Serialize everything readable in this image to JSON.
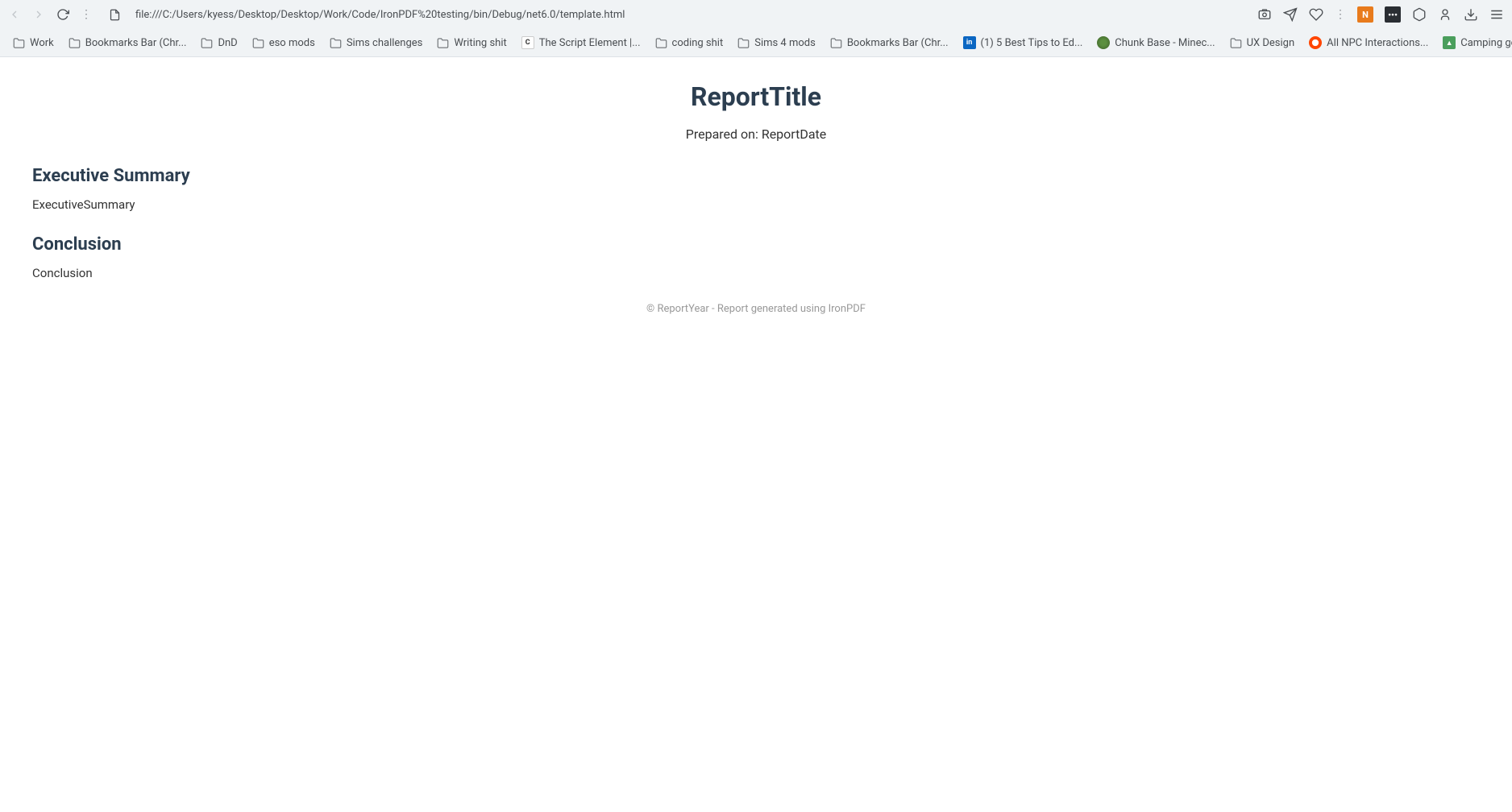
{
  "browser": {
    "url": "file:///C:/Users/kyess/Desktop/Desktop/Work/Code/IronPDF%20testing/bin/Debug/net6.0/template.html"
  },
  "bookmarks": [
    {
      "type": "folder",
      "label": "Work"
    },
    {
      "type": "folder",
      "label": "Bookmarks Bar (Chr..."
    },
    {
      "type": "folder",
      "label": "DnD"
    },
    {
      "type": "folder",
      "label": "eso mods"
    },
    {
      "type": "folder",
      "label": "Sims challenges"
    },
    {
      "type": "folder",
      "label": "Writing shit"
    },
    {
      "type": "script",
      "label": "The Script Element |..."
    },
    {
      "type": "folder",
      "label": "coding shit"
    },
    {
      "type": "folder",
      "label": "Sims 4 mods"
    },
    {
      "type": "folder",
      "label": "Bookmarks Bar (Chr..."
    },
    {
      "type": "linkedin",
      "label": "(1) 5 Best Tips to Ed..."
    },
    {
      "type": "chunkbase",
      "label": "Chunk Base - Minec..."
    },
    {
      "type": "folder",
      "label": "UX Design"
    },
    {
      "type": "reddit",
      "label": "All NPC Interactions..."
    },
    {
      "type": "camping",
      "label": "Camping gear list:..."
    }
  ],
  "report": {
    "title": "ReportTitle",
    "date_prefix": "Prepared on: ",
    "date": "ReportDate",
    "section1_heading": "Executive Summary",
    "section1_text": "ExecutiveSummary",
    "section2_heading": "Conclusion",
    "section2_text": "Conclusion",
    "footer": "© ReportYear - Report generated using IronPDF"
  }
}
